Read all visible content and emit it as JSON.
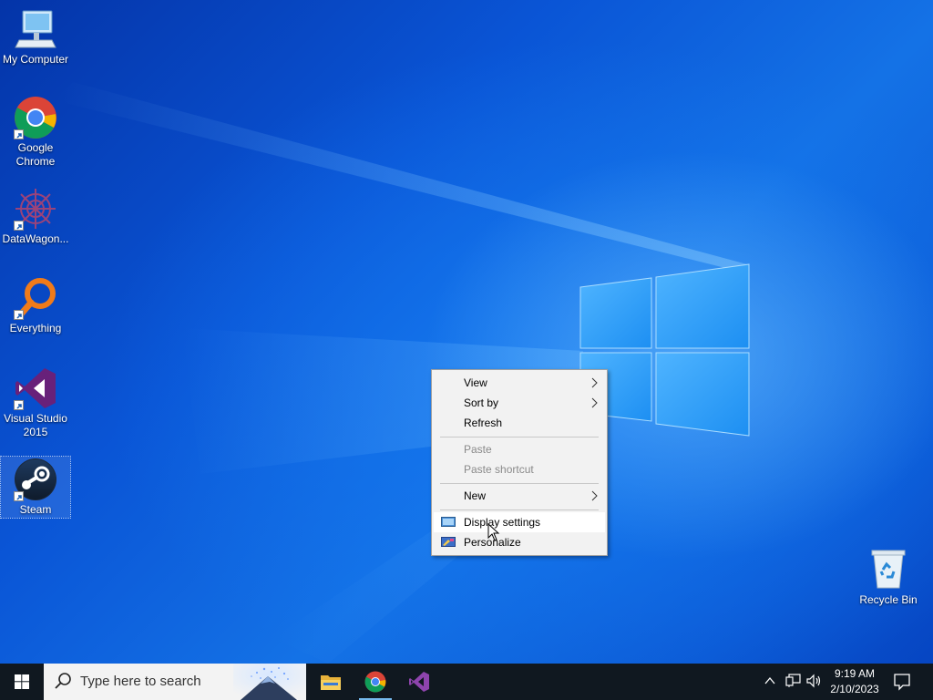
{
  "desktop_icons": [
    {
      "label": "My Computer"
    },
    {
      "label": "Google Chrome"
    },
    {
      "label": "DataWagon..."
    },
    {
      "label": "Everything"
    },
    {
      "label": "Visual Studio 2015"
    },
    {
      "label": "Steam"
    },
    {
      "label": "Recycle Bin"
    }
  ],
  "context_menu": {
    "items": [
      {
        "label": "View",
        "has_submenu": true
      },
      {
        "label": "Sort by",
        "has_submenu": true
      },
      {
        "label": "Refresh"
      },
      {
        "label": "Paste",
        "disabled": true
      },
      {
        "label": "Paste shortcut",
        "disabled": true
      },
      {
        "label": "New",
        "has_submenu": true
      },
      {
        "label": "Display settings",
        "icon": "display-icon",
        "highlighted": true
      },
      {
        "label": "Personalize",
        "icon": "personalize-icon"
      }
    ]
  },
  "taskbar": {
    "search_placeholder": "Type here to search",
    "apps": [
      {
        "icon": "file-explorer-icon"
      },
      {
        "icon": "chrome-icon",
        "active": true
      },
      {
        "icon": "visual-studio-icon"
      }
    ],
    "clock": {
      "time": "9:19 AM",
      "date": "2/10/2023"
    }
  },
  "colors": {
    "desktop_blue": "#0a55d6",
    "taskbar": "#101820",
    "menu_bg": "#f2f2f2",
    "active_indicator": "#76b9ed"
  }
}
